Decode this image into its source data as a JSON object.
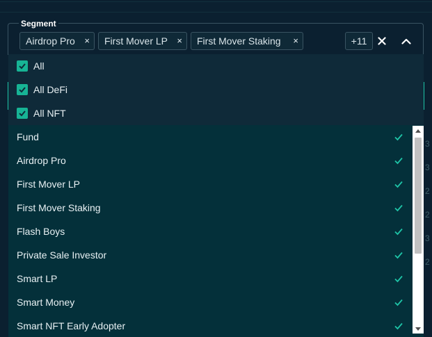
{
  "segment": {
    "legend": "Segment",
    "chips": [
      "Airdrop Pro",
      "First Mover LP",
      "First Mover Staking"
    ],
    "chip_remove_glyph": "×",
    "more_count": "+11",
    "clear_icon": "close-icon",
    "collapse_icon": "chevron-up-icon"
  },
  "group_options": [
    "All",
    "All DeFi",
    "All NFT"
  ],
  "options": [
    "Fund",
    "Airdrop Pro",
    "First Mover LP",
    "First Mover Staking",
    "Flash Boys",
    "Private Sale Investor",
    "Smart LP",
    "Smart Money",
    "Smart NFT Early Adopter"
  ],
  "colors": {
    "accent": "#1ec4a7",
    "checkbox": "#17b495",
    "group_panel": "#0f2a39",
    "list_panel": "#04303a",
    "background": "#0b2030"
  }
}
